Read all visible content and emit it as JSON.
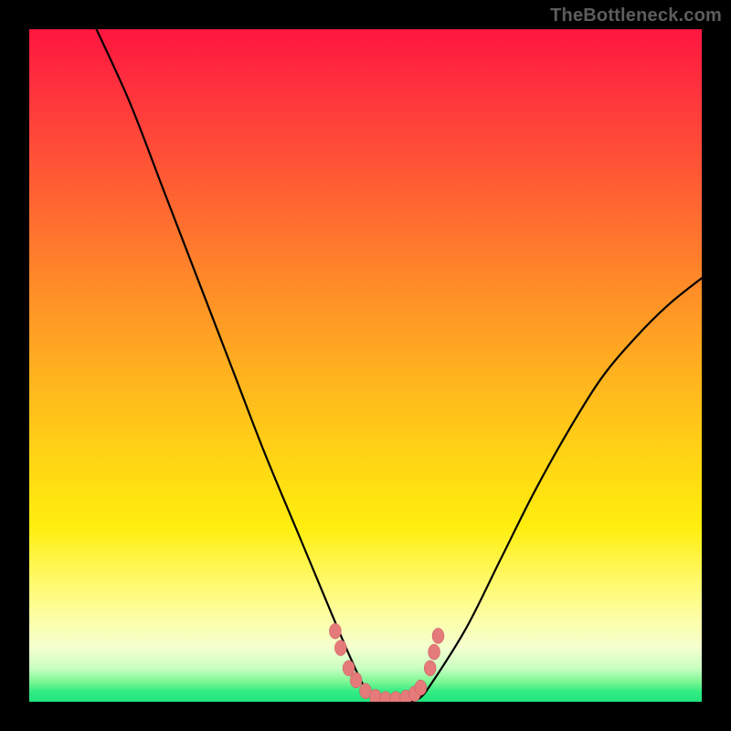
{
  "watermark": "TheBottleneck.com",
  "colors": {
    "frame": "#000000",
    "gradient_top": "#ff163f",
    "gradient_mid": "#ffee0e",
    "gradient_bottom": "#1fe47e",
    "curve": "#000000",
    "marker_fill": "#e57a7a",
    "marker_stroke": "#c95a5a"
  },
  "chart_data": {
    "type": "line",
    "title": "",
    "xlabel": "",
    "ylabel": "",
    "xlim": [
      0,
      100
    ],
    "ylim": [
      0,
      100
    ],
    "note": "Axes are unlabeled; y=0 is the green baseline (no bottleneck), y=100 is the red top (max bottleneck). Values are read off as percent of plot height. Curve is a V-shaped well touching ~0 near x≈50–57.",
    "series": [
      {
        "name": "bottleneck-curve",
        "x": [
          10,
          15,
          20,
          25,
          30,
          35,
          40,
          45,
          48,
          50,
          52,
          54,
          56,
          58,
          60,
          65,
          70,
          75,
          80,
          85,
          90,
          95,
          100
        ],
        "y": [
          100,
          89,
          76,
          63,
          50,
          37,
          25,
          13,
          6,
          2,
          0.5,
          0,
          0,
          0.5,
          3,
          11,
          21,
          31,
          40,
          48,
          54,
          59,
          63
        ]
      }
    ],
    "markers": {
      "name": "highlight-dots",
      "note": "Small salmon dots clustered around the well bottom and shoulders.",
      "points": [
        {
          "x": 45.5,
          "y": 10.5
        },
        {
          "x": 46.3,
          "y": 8.0
        },
        {
          "x": 47.5,
          "y": 5.0
        },
        {
          "x": 48.6,
          "y": 3.2
        },
        {
          "x": 50.0,
          "y": 1.6
        },
        {
          "x": 51.5,
          "y": 0.7
        },
        {
          "x": 53.0,
          "y": 0.4
        },
        {
          "x": 54.5,
          "y": 0.4
        },
        {
          "x": 56.0,
          "y": 0.6
        },
        {
          "x": 57.3,
          "y": 1.2
        },
        {
          "x": 58.2,
          "y": 2.1
        },
        {
          "x": 59.6,
          "y": 5.0
        },
        {
          "x": 60.2,
          "y": 7.4
        },
        {
          "x": 60.8,
          "y": 9.8
        }
      ]
    }
  }
}
